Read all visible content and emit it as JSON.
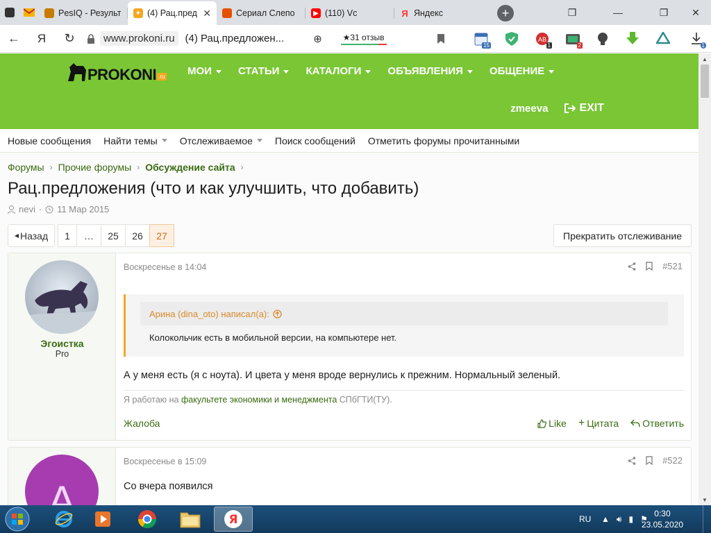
{
  "browser": {
    "tabs": [
      {
        "title": "",
        "favicon_color": "#333333",
        "icon": "messenger-icon"
      },
      {
        "title": "",
        "favicon_color": "#f4b400",
        "icon": "mail-icon"
      },
      {
        "title": "PesIQ - Результ",
        "favicon_color": "#c77b00",
        "icon": "dog-icon"
      },
      {
        "title": "(4) Рац.пред",
        "favicon_color": "#f5a623",
        "icon": "horse-icon",
        "active": true
      },
      {
        "title": "Сериал Слепо",
        "favicon_color": "#e65100",
        "icon": "fire-icon"
      },
      {
        "title": "(110) Vc",
        "favicon_color": "#ff0000",
        "icon": "youtube-icon"
      },
      {
        "title": "Яндекс",
        "favicon_color": "#ff3333",
        "icon": "yandex-icon"
      }
    ],
    "domain": "www.prokoni.ru",
    "page_title": "(4) Рац.предложен...",
    "reviews": "★31 отзыв",
    "ext_badges": {
      "calendar": "15",
      "adblock": "1",
      "mail": "2",
      "download": "1"
    },
    "yandex_glyph": "Я"
  },
  "site": {
    "logo": "PROKONI",
    "logo_suffix": ".ru",
    "nav": [
      "МОИ",
      "СТАТЬИ",
      "КАТАЛОГИ",
      "ОБЪЯВЛЕНИЯ",
      "ОБЩЕНИЕ"
    ],
    "username": "zmeeva",
    "exit": "EXIT",
    "sub_nav": [
      {
        "label": "Новые сообщения",
        "caret": false
      },
      {
        "label": "Найти темы",
        "caret": true
      },
      {
        "label": "Отслеживаемое",
        "caret": true
      },
      {
        "label": "Поиск сообщений",
        "caret": false
      },
      {
        "label": "Отметить форумы прочитанными",
        "caret": false
      }
    ]
  },
  "thread": {
    "breadcrumb": [
      "Форумы",
      "Прочие форумы",
      "Обсуждение сайта"
    ],
    "title": "Рац.предложения (что и как улучшить, что добавить)",
    "author": "nevi",
    "date": "11 Мар 2015",
    "pager": {
      "prev": "Назад",
      "pages": [
        "1",
        "…",
        "25",
        "26",
        "27"
      ],
      "current": "27"
    },
    "unwatch": "Прекратить отслеживание"
  },
  "posts": [
    {
      "username": "Эгоистка",
      "user_title": "Pro",
      "date": "Воскресенье в 14:04",
      "number": "#521",
      "quote_author": "Арина (dina_oto) написал(а):",
      "quote_text": "Колокольчик есть в мобильной версии, на компьютере нет.",
      "text": "А у меня есть (я с ноута). И цвета у меня вроде вернулись к прежним. Нормальный зеленый.",
      "signature_prefix": "Я работаю на",
      "signature_link": "факультете экономики и менеджмента",
      "signature_suffix": "СПбГТИ(ТУ).",
      "actions": {
        "report": "Жалоба",
        "like": "Like",
        "quote": "Цитата",
        "reply": "Ответить"
      }
    },
    {
      "avatar_letter": "А",
      "avatar_color": "#a63cb0",
      "date": "Воскресенье в 15:09",
      "number": "#522",
      "text": "Со вчера появился"
    }
  ],
  "taskbar": {
    "lang": "RU",
    "time": "0:30",
    "date": "23.05.2020"
  },
  "colors": {
    "brand_green": "#7ac634",
    "link_green": "#3a6b12",
    "quote_orange": "#f5a623"
  }
}
